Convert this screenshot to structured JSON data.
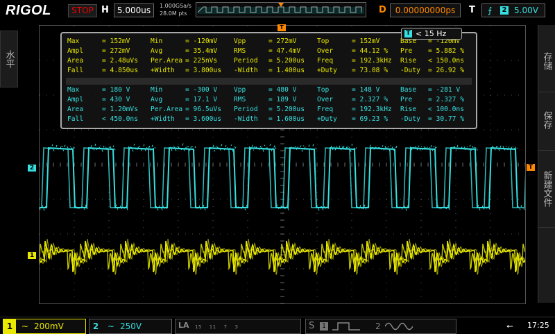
{
  "header": {
    "logo": "RIGOL",
    "run_state": "STOP",
    "h_label": "H",
    "timebase": "5.000us",
    "sample_rate": "1.000GSa/s",
    "memory_depth": "28.0M pts",
    "d_label": "D",
    "delay": "0.00000000ps",
    "t_label": "T",
    "trigger_source": "2",
    "trigger_level": "5.00V"
  },
  "left_tab": {
    "label": "水平"
  },
  "right_tabs": [
    {
      "label": "存储"
    },
    {
      "label": "保存"
    },
    {
      "label": "新建文件"
    }
  ],
  "markers": {
    "ch2": "2",
    "ch1": "1",
    "trigger": "T"
  },
  "filter_badge": {
    "label": "< 15 Hz"
  },
  "measurements": {
    "ch1": [
      [
        "Max",
        "= 152mV",
        "Min",
        "= -120mV",
        "Vpp",
        "= 272mV",
        "Top",
        "= 152mV",
        "Base",
        "= -120mV"
      ],
      [
        "Ampl",
        "= 272mV",
        "Avg",
        "= 35.4mV",
        "RMS",
        "= 47.4mV",
        "Over",
        "= 44.12 %",
        "Pre",
        "= 5.882 %"
      ],
      [
        "Area",
        "= 2.48uVs",
        "Per.Area",
        "= 225nVs",
        "Period",
        "= 5.200us",
        "Freq",
        "= 192.3kHz",
        "Rise",
        "< 150.0ns"
      ],
      [
        "Fall",
        "= 4.850us",
        "+Width",
        "= 3.800us",
        "-Width",
        "= 1.400us",
        "+Duty",
        "= 73.08 %",
        "-Duty",
        "= 26.92 %"
      ]
    ],
    "ch2": [
      [
        "Max",
        "= 180 V",
        "Min",
        "= -300 V",
        "Vpp",
        "= 480 V",
        "Top",
        "= 148 V",
        "Base",
        "= -281 V"
      ],
      [
        "Ampl",
        "= 430 V",
        "Avg",
        "= 17.1 V",
        "RMS",
        "= 189 V",
        "Over",
        "= 2.327 %",
        "Pre",
        "= 2.327 %"
      ],
      [
        "Area",
        "= 1.20mVs",
        "Per.Area",
        "= 96.5uVs",
        "Period",
        "= 5.200us",
        "Freq",
        "= 192.3kHz",
        "Rise",
        "< 100.0ns"
      ],
      [
        "Fall",
        "< 450.0ns",
        "+Width",
        "= 3.600us",
        "-Width",
        "= 1.600us",
        "+Duty",
        "= 69.23 %",
        "-Duty",
        "= 30.77 %"
      ]
    ]
  },
  "footer": {
    "ch1": {
      "num": "1",
      "coupling": "~",
      "scale": "200mV"
    },
    "ch2": {
      "num": "2",
      "coupling": "~",
      "scale": "250V"
    },
    "la": {
      "label": "LA",
      "channels": "15    11    7    3"
    },
    "decode": {
      "s": "S",
      "n1": "1",
      "n2": "2"
    },
    "status": {
      "usb": "⭠",
      "time": "17:25"
    }
  },
  "colors": {
    "ch1": "#e8e800",
    "ch2": "#36e0e0",
    "trigger": "#ff8800",
    "stop": "#ee0000"
  },
  "waveforms": {
    "ch2_square": {
      "period_us": 5.2,
      "positive_width_us": 3.6
    },
    "ch1_ringing": {
      "period_us": 5.2
    }
  }
}
